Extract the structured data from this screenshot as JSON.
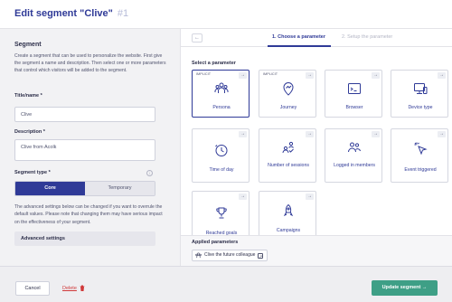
{
  "header": {
    "title": "Edit segment \"Clive\"",
    "number": "#1"
  },
  "left": {
    "section_title": "Segment",
    "description": "Create a segment that can be used to personalize the website. First give the segment a name and description. Then select one or more parameters that control which visitors will be added to the segment.",
    "title_label": "Title/name *",
    "title_value": "Clive",
    "description_label": "Description *",
    "description_value": "Clive from Acolk",
    "segment_type_label": "Segment type *",
    "segment_type_options": [
      "Core",
      "Temporary"
    ],
    "advanced_desc": "The advanced settings below can be changed if you want to overrule the default values. Please note that changing them may have serious impact on the effectiveness of your segment.",
    "advanced_button": "Advanced settings"
  },
  "steps": {
    "back": "←",
    "step1": "1. Choose a parameter",
    "step2": "2. Setup the parameter"
  },
  "select_label": "Select a parameter",
  "implicit_tag": "IMPLICIT",
  "cards": [
    {
      "name": "Persona",
      "icon": "persona-icon",
      "implicit": true
    },
    {
      "name": "Journey",
      "icon": "journey-icon",
      "implicit": true
    },
    {
      "name": "Browser",
      "icon": "browser-icon",
      "implicit": false
    },
    {
      "name": "Device type",
      "icon": "device-icon",
      "implicit": false
    },
    {
      "name": "Time of day",
      "icon": "clock-icon",
      "implicit": false
    },
    {
      "name": "Number of sessions",
      "icon": "sessions-icon",
      "implicit": false
    },
    {
      "name": "Logged in members",
      "icon": "members-icon",
      "implicit": false
    },
    {
      "name": "Event triggered",
      "icon": "cursor-icon",
      "implicit": false
    },
    {
      "name": "Reached goals",
      "icon": "goal-icon",
      "implicit": false
    },
    {
      "name": "Campaigns",
      "icon": "campaign-icon",
      "implicit": false
    }
  ],
  "applied": {
    "label": "Applied parameters",
    "chip": "Clive the future colleague"
  },
  "footer": {
    "cancel": "Cancel",
    "delete": "Delete",
    "update": "Update segment →"
  },
  "colors": {
    "primary": "#2f3a97",
    "success": "#3e9f86",
    "danger": "#d0393a"
  }
}
